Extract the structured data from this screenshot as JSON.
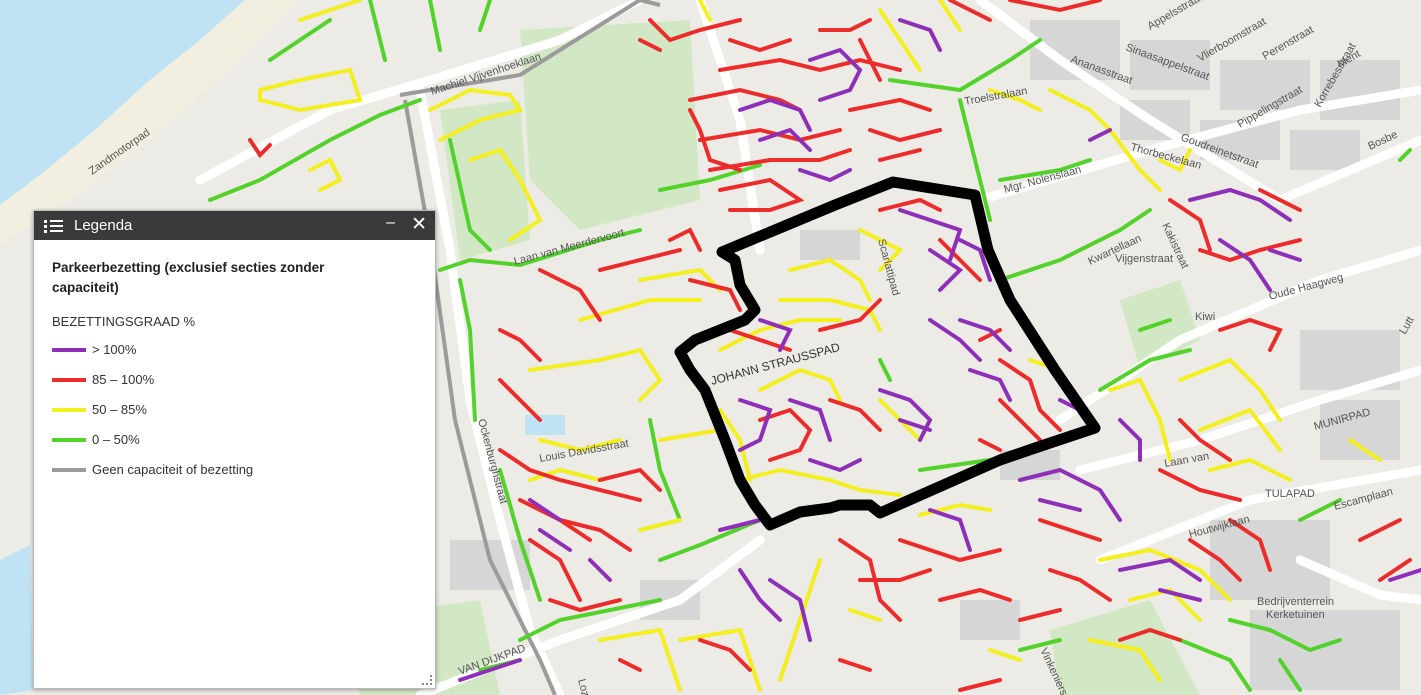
{
  "colors": {
    "over100": "#8e2fb8",
    "r85_100": "#ec2b2b",
    "r50_85": "#f4ef1e",
    "r0_50": "#52d22b",
    "nocap": "#9b9b9b",
    "boundary": "#000000",
    "water": "#bfe3f5",
    "park": "#d2e8c5",
    "building": "#cfcfcf",
    "road": "#ffffff"
  },
  "legend": {
    "title": "Legenda",
    "minimize": "–",
    "close": "✕",
    "heading": "Parkeerbezetting (exclusief secties zonder capaciteit)",
    "subheading": "BEZETTINGSGRAAD %",
    "items": [
      {
        "label": "> 100%",
        "color": "#8e2fb8"
      },
      {
        "label": "85 – 100%",
        "color": "#ec2b2b"
      },
      {
        "label": "50 – 85%",
        "color": "#f4ef1e"
      },
      {
        "label": "0 – 50%",
        "color": "#52d22b"
      },
      {
        "label": "Geen capaciteit of bezetting",
        "color": "#9b9b9b"
      }
    ]
  },
  "map_labels": {
    "zandmotorpad": "Zandmotorpad",
    "machiel": "Machiel Vijvenhoeklaan",
    "appelsstraat": "Appelsstraat",
    "ananasstraat": "Ananasstraat",
    "sinaasappelstraat": "Sinaasappelstraat",
    "vlierboomstraat": "Vlierboomstraat",
    "perenstraat": "Perenstraat",
    "ment": "Ment",
    "korrebessstraat": "Korrebesstraat",
    "goudreinetstraat": "Goudreinetstraat",
    "pippelingstraat": "Pippelingstraat",
    "thorbeckelaan": "Thorbeckelaan",
    "bosbes": "Bosbe",
    "mgr_nolenslaan": "Mgr. Nolenslaan",
    "troelstralaan": "Troelstralaan",
    "strauss": "JOHANN STRAUSSPAD",
    "oude_haagweg": "Oude Haagweg",
    "munirpad": "MUNIRPAD",
    "laan_van": "Laan van",
    "tulapad": "TULAPAD",
    "escamplaan": "Escamplaan",
    "houtwijklaan": "Houtwijklaan",
    "bedrijventerrein": "Bedrijventerrein",
    "kerketuinen": "Kerketuinen",
    "van_dijkpad": "VAN DIJKPAD",
    "ockenburg": "Ockenburghstraat",
    "kwartellaan": "Kwartellaan",
    "vijgenstraat": "Vijgenstraat",
    "kakistraat": "Kakistraat",
    "kiwistraat": "Kiwi",
    "scarlattipad": "Scarlattipad",
    "laan_van_meerdervoort": "Laan van Meerdervoort",
    "louis_davids": "Louis Davidsstraat",
    "loz": "Loz",
    "lutt": "Lutt",
    "vinkeniers": "Vinkeniers"
  }
}
